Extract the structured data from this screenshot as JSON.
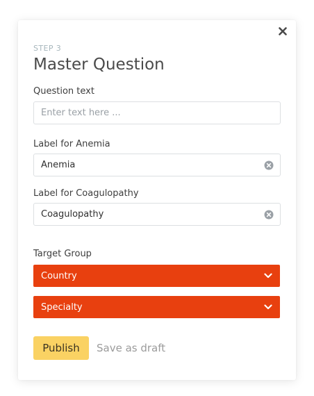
{
  "modal": {
    "step": "STEP 3",
    "title": "Master Question",
    "question_label": "Question text",
    "question_placeholder": "Enter text here ...",
    "anemia_label": "Label for Anemia",
    "anemia_value": "Anemia",
    "coag_label": "Label for Coagulopathy",
    "coag_value": "Coagulopathy",
    "target_group_label": "Target Group",
    "selects": [
      {
        "label": "Country"
      },
      {
        "label": "Specialty"
      }
    ],
    "publish_label": "Publish",
    "draft_label": "Save as draft"
  },
  "icons": {
    "close": "close-icon",
    "clear": "clear-circle-icon",
    "chevron": "chevron-down-icon"
  },
  "colors": {
    "accent_select": "#e8400f",
    "publish_bg": "#fad263",
    "step_text": "#a7b6bc",
    "muted_text": "#9b9b9b"
  }
}
